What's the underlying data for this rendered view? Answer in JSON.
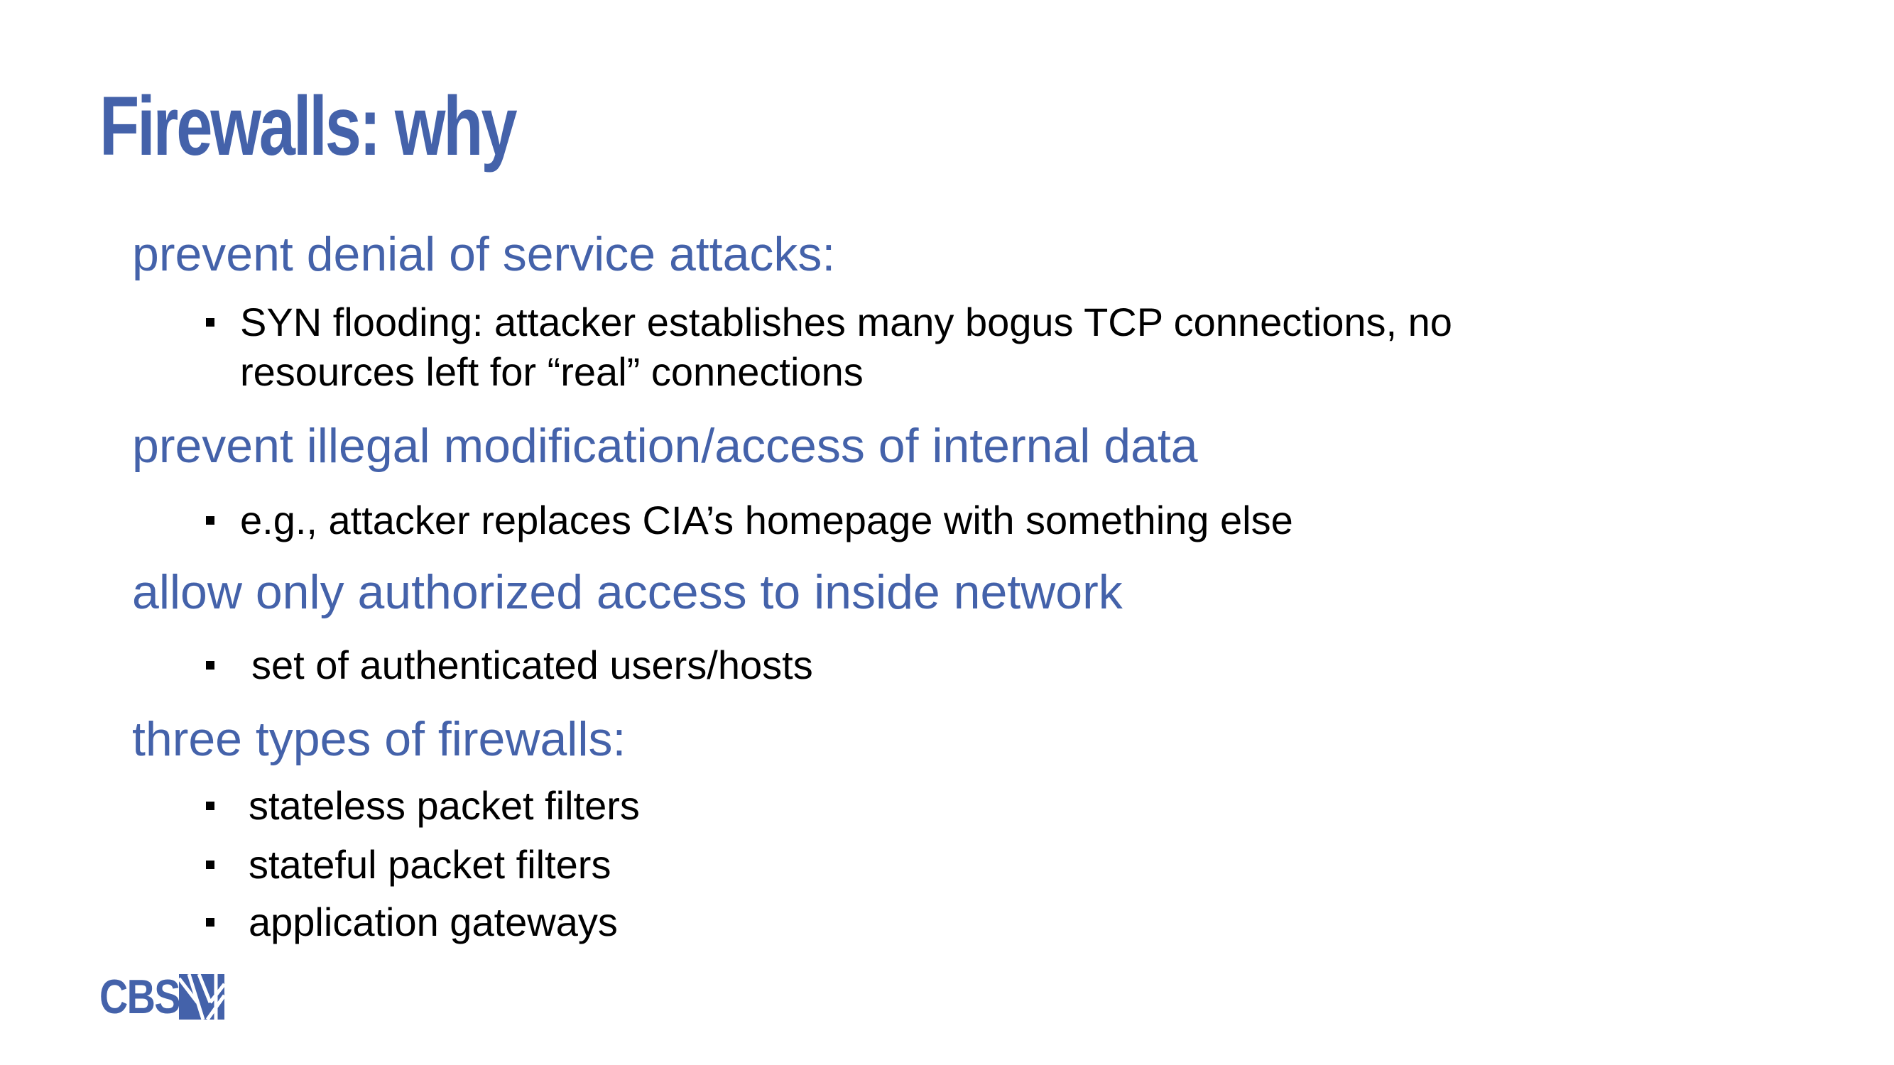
{
  "slide": {
    "title": "Firewalls: why",
    "sections": [
      {
        "heading": "prevent denial of service attacks:",
        "items": [
          "SYN flooding: attacker establishes many bogus TCP connections, no",
          "resources left for “real” connections"
        ]
      },
      {
        "heading": "prevent illegal modification/access of internal data",
        "items": [
          "e.g., attacker replaces CIA’s homepage with something else"
        ]
      },
      {
        "heading": "allow only authorized access to inside network",
        "items": [
          "set of authenticated users/hosts"
        ]
      },
      {
        "heading": "three types of firewalls:",
        "items": [
          "stateless packet filters",
          "stateful packet filters",
          "application gateways"
        ]
      }
    ],
    "accent_color": "#4462aa",
    "text_color": "#000000",
    "bullet_icon": "square-bullet-icon"
  },
  "footer": {
    "logo_text": "CBS",
    "logo_icon": "cbs-logo-icon"
  }
}
